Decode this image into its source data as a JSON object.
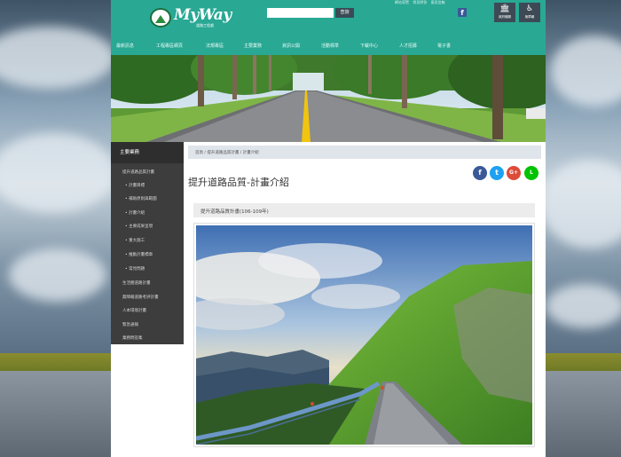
{
  "brand": {
    "name": "MyWay",
    "subtitle": "道路工程處"
  },
  "search": {
    "placeholder": "",
    "button_label": "查詢"
  },
  "top_links": [
    "網站導覽",
    "常見問答",
    "意見信箱"
  ],
  "badges": [
    {
      "label": "政府機關",
      "icon": "building-icon"
    },
    {
      "label": "無障礙",
      "icon": "accessibility-icon"
    }
  ],
  "nav": [
    "最新訊息",
    "工程專區網頁",
    "法規專區",
    "主要業務",
    "資訊公開",
    "活動標準",
    "下載中心",
    "人才招募",
    "電子書"
  ],
  "sidebar": {
    "title": "主要業務",
    "items": [
      {
        "label": "提升道路品質計畫",
        "level": 0
      },
      {
        "label": "計畫目標",
        "level": 1
      },
      {
        "label": "補助原則與範圍",
        "level": 1
      },
      {
        "label": "計畫介紹",
        "level": 1
      },
      {
        "label": "主要成果呈現",
        "level": 1
      },
      {
        "label": "重大施工",
        "level": 1
      },
      {
        "label": "推動計畫標章",
        "level": 1
      },
      {
        "label": "常見問題",
        "level": 1
      },
      {
        "label": "生活圈道路計畫",
        "level": 0
      },
      {
        "label": "無障礙道路考評計畫",
        "level": 0
      },
      {
        "label": "人本環境計畫",
        "level": 0
      },
      {
        "label": "緊急通報",
        "level": 0
      },
      {
        "label": "業務問答集",
        "level": 0
      }
    ]
  },
  "breadcrumb": "首頁 / 提升道路品質計畫 / 計畫介紹",
  "page_title": "提升道路品質-計畫介紹",
  "share_buttons": [
    {
      "icon": "facebook-icon",
      "glyph": "f",
      "color": "#3b5998"
    },
    {
      "icon": "twitter-icon",
      "glyph": "t",
      "color": "#1da1f2"
    },
    {
      "icon": "google-plus-icon",
      "glyph": "G+",
      "color": "#dd4b39"
    },
    {
      "icon": "line-icon",
      "glyph": "L",
      "color": "#00c300"
    }
  ],
  "section_title": "提升道路品質計畫(106-109年)",
  "colors": {
    "header": "#29a894",
    "sidebar": "#3d3d3d",
    "accent": "#2d8b3f"
  }
}
